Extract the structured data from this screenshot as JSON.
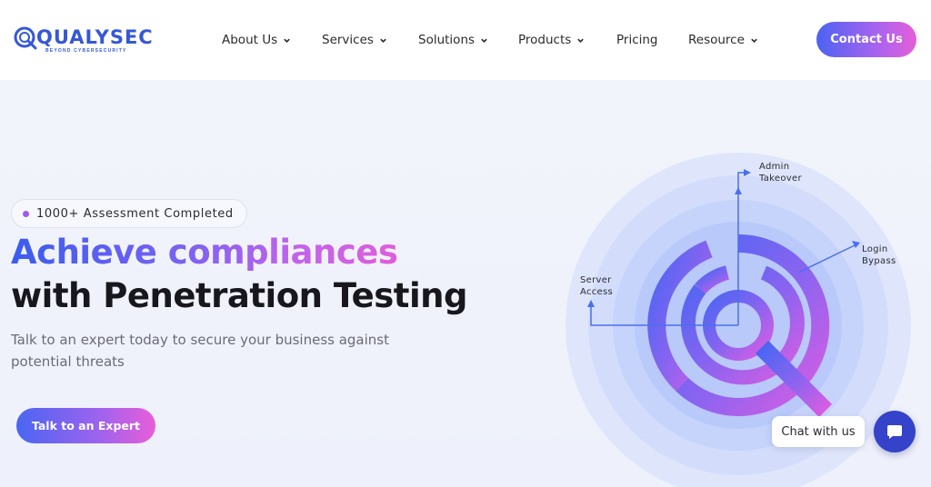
{
  "brand": {
    "name": "QUALYSEC",
    "tagline": "BEYOND CYBERSECURITY",
    "primary_color": "#3557d8",
    "gradient_start": "#4c63f2",
    "gradient_end": "#e55fd8"
  },
  "nav": {
    "items": [
      {
        "label": "About Us",
        "has_dropdown": true
      },
      {
        "label": "Services",
        "has_dropdown": true
      },
      {
        "label": "Solutions",
        "has_dropdown": true
      },
      {
        "label": "Products",
        "has_dropdown": true
      },
      {
        "label": "Pricing",
        "has_dropdown": false
      },
      {
        "label": "Resource",
        "has_dropdown": true
      }
    ],
    "contact_label": "Contact Us"
  },
  "hero": {
    "badge": "1000+ Assessment Completed",
    "headline_gradient": "Achieve compliances",
    "headline_plain": "with Penetration Testing",
    "subtext": "Talk to an expert today to secure your business against potential threats",
    "cta_label": "Talk to an Expert"
  },
  "illustration": {
    "labels": {
      "admin_1": "Admin",
      "admin_2": "Takeover",
      "login_1": "Login",
      "login_2": "Bypass",
      "server_1": "Server",
      "server_2": "Access"
    }
  },
  "chat": {
    "label": "Chat with us",
    "icon": "chat-icon"
  }
}
